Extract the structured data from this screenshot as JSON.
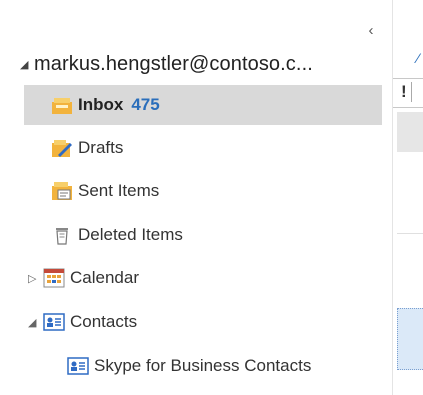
{
  "account": {
    "name": "markus.hengstler@contoso.c..."
  },
  "folders": [
    {
      "label": "Inbox",
      "count": "475"
    },
    {
      "label": "Drafts"
    },
    {
      "label": "Sent Items"
    },
    {
      "label": "Deleted Items"
    },
    {
      "label": "Calendar"
    },
    {
      "label": "Contacts"
    },
    {
      "label": "Skype for Business Contacts"
    }
  ],
  "list_pane": {
    "column_important": "!"
  },
  "icons": {
    "collapse": "chevron-left-icon",
    "inbox": "inbox-icon",
    "drafts": "drafts-icon",
    "sent": "sent-items-icon",
    "deleted": "trash-icon",
    "calendar": "calendar-icon",
    "contacts": "contacts-icon"
  },
  "colors": {
    "count": "#2a6ebb",
    "selected_bg": "#d9d9d9"
  }
}
